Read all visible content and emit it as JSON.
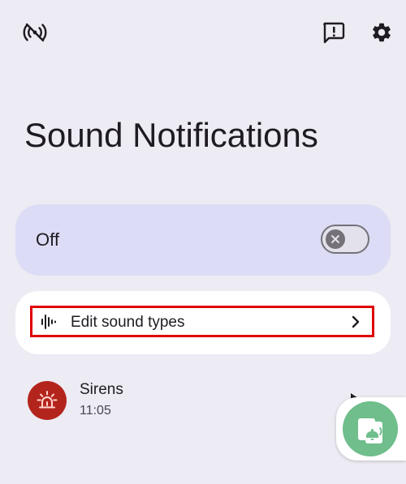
{
  "header": {
    "title": "Sound Notifications",
    "icons": {
      "left": "radio-off-icon",
      "feedback": "feedback-icon",
      "settings": "gear-icon"
    }
  },
  "main_toggle": {
    "label": "Off",
    "state": "off"
  },
  "edit_sound_types": {
    "label": "Edit sound types",
    "icon": "waveform-icon"
  },
  "events": [
    {
      "title": "Sirens",
      "time": "11:05",
      "icon": "siren-icon"
    }
  ],
  "colors": {
    "background": "#edebf3",
    "toggle_card": "#dcdcf6",
    "highlight_border": "#e00000",
    "siren_avatar": "#b3251c",
    "fab": "#6fbe8b"
  },
  "fab": {
    "icon": "sound-notification-app-icon"
  }
}
